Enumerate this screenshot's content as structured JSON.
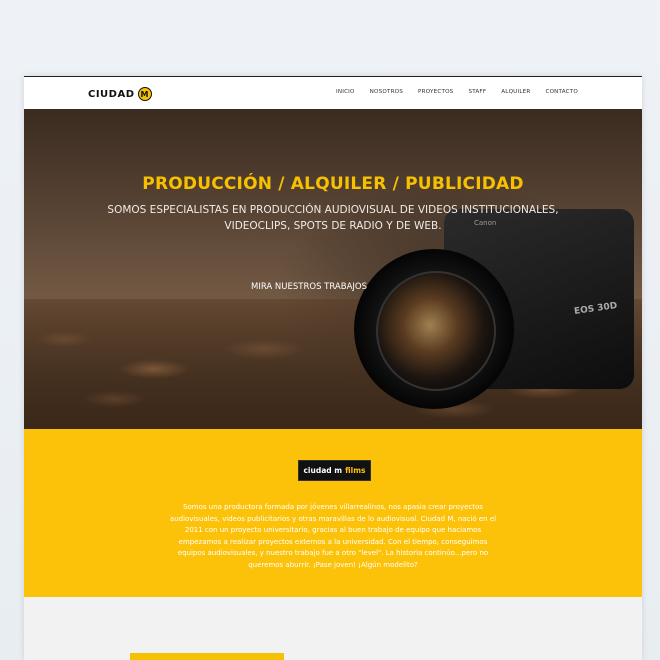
{
  "brand": {
    "name": "CIUDAD",
    "badge": "M"
  },
  "nav": [
    "INICIO",
    "NOSOTROS",
    "PROYECTOS",
    "STAFF",
    "ALQUILER",
    "CONTACTO"
  ],
  "hero": {
    "title": "PRODUCCIÓN / ALQUILER / PUBLICIDAD",
    "subtitle": "SOMOS ESPECIALISTAS EN PRODUCCIÓN AUDIOVISUAL DE VIDEOS INSTITUCIONALES, VIDEOCLIPS, SPOTS DE RADIO Y DE WEB.",
    "cta": "MIRA NUESTROS TRABAJOS",
    "camera_brand": "Canon",
    "camera_model": "EOS 30D"
  },
  "about": {
    "badge_white": "ciudad m",
    "badge_yellow": "films",
    "text": "Somos una productora formada por jóvenes villarrealinos, nos apasia crear proyectos audiovisuales, videos publicitarios y otras maravillas de lo audiovisual. Ciudad M, nació en el 2011 con un proyecto universitario, gracias al buen trabajo de equipo que haciamos empezamos a realizar proyectos externos a la universidad. Con el tiempo, conseguimos equipos audiovisuales, y nuestro trabajo fue a otro \"level\". La historia continúo...pero no queremos aburrir. ¡Pase joven! ¡Algún modelito?"
  },
  "colors": {
    "accent": "#fcc20a",
    "dark": "#111111"
  }
}
